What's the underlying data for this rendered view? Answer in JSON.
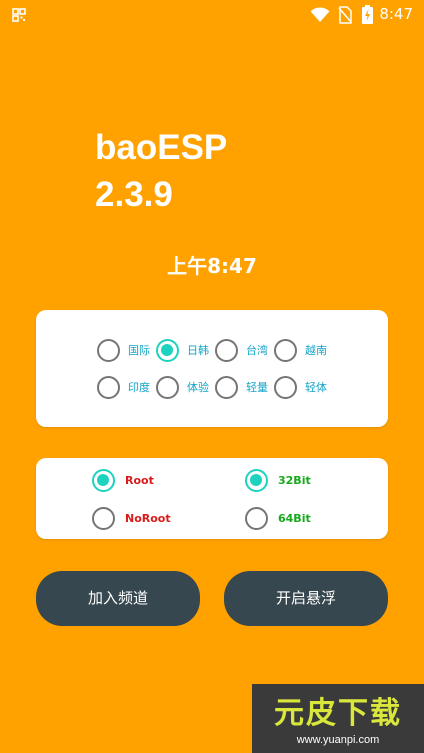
{
  "status_bar": {
    "time": "8:47",
    "left_icon": "qr-grid-icon",
    "icons": [
      "wifi-icon",
      "no-sim-icon",
      "battery-charging-icon"
    ]
  },
  "app": {
    "name": "baoESP",
    "version": "2.3.9",
    "clock": "上午8:47"
  },
  "region_group": {
    "options": [
      {
        "label": "国际",
        "selected": false
      },
      {
        "label": "日韩",
        "selected": true
      },
      {
        "label": "台湾",
        "selected": false
      },
      {
        "label": "越南",
        "selected": false
      },
      {
        "label": "印度",
        "selected": false
      },
      {
        "label": "体验",
        "selected": false
      },
      {
        "label": "轻量",
        "selected": false
      },
      {
        "label": "轻体",
        "selected": false
      }
    ]
  },
  "mode_group": {
    "root": {
      "label": "Root",
      "selected": true
    },
    "noroot": {
      "label": "NoRoot",
      "selected": false
    },
    "bit32": {
      "label": "32Bit",
      "selected": true
    },
    "bit64": {
      "label": "64Bit",
      "selected": false
    }
  },
  "buttons": {
    "join_channel": "加入频道",
    "open_float": "开启悬浮"
  },
  "watermark": {
    "title": "元皮下载",
    "url": "www.yuanpi.com"
  },
  "colors": {
    "background": "#FFA200",
    "accent": "#1DD3C0",
    "button": "#37474F",
    "label_blue": "#13A4C8",
    "label_red": "#D81B1B",
    "label_green": "#17A91C"
  }
}
